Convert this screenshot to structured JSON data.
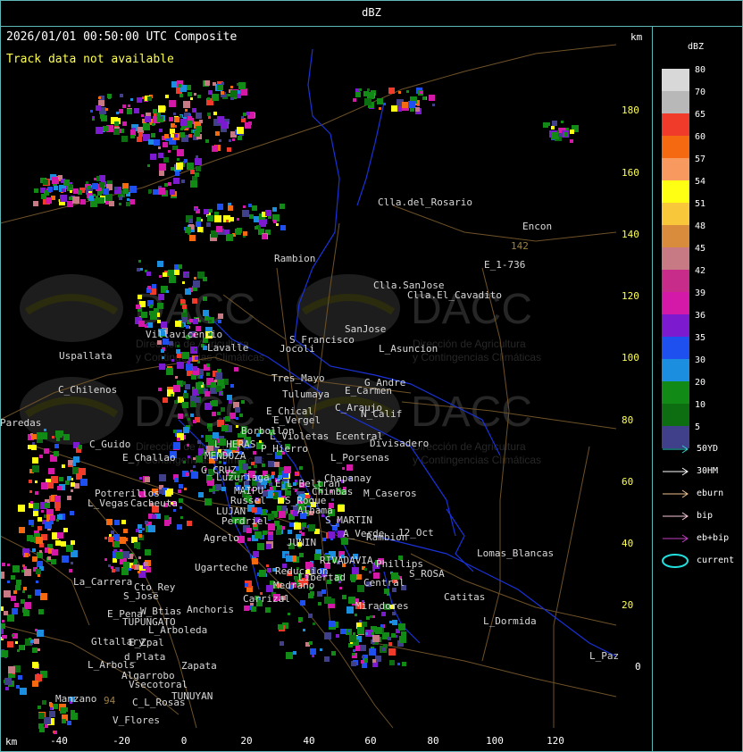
{
  "header": {
    "title": "dBZ"
  },
  "status": {
    "timestamp": "2026/01/01 00:50:00 UTC Composite",
    "track_message": "Track data not available",
    "km_top": "km",
    "km_bottom": "km"
  },
  "axes": {
    "x_ticks": [
      "-40",
      "-20",
      "0",
      "20",
      "40",
      "60",
      "80",
      "100",
      "120"
    ],
    "y_ticks": [
      "180",
      "160",
      "140",
      "120",
      "100",
      "80",
      "60",
      "40",
      "20",
      "0"
    ]
  },
  "legend": {
    "title": "dBZ",
    "scale": [
      {
        "label": "80",
        "color": "#d8d8d8"
      },
      {
        "label": "70",
        "color": "#b8b8b8"
      },
      {
        "label": "65",
        "color": "#f03a2a"
      },
      {
        "label": "60",
        "color": "#f56a10"
      },
      {
        "label": "57",
        "color": "#f89a60"
      },
      {
        "label": "54",
        "color": "#ffff14"
      },
      {
        "label": "51",
        "color": "#f8c83a"
      },
      {
        "label": "48",
        "color": "#d88c3c"
      },
      {
        "label": "45",
        "color": "#c87a84"
      },
      {
        "label": "42",
        "color": "#c82c8a"
      },
      {
        "label": "39",
        "color": "#d418a8"
      },
      {
        "label": "36",
        "color": "#7c1ad0"
      },
      {
        "label": "35",
        "color": "#1e50f0"
      },
      {
        "label": "30",
        "color": "#1c8ee0"
      },
      {
        "label": "20",
        "color": "#128a16"
      },
      {
        "label": "10",
        "color": "#0c6e10"
      },
      {
        "label": "5",
        "color": "#3f3f8a"
      }
    ],
    "tracks": [
      {
        "label": "50YD",
        "color": "#34d0d0"
      },
      {
        "label": "30HM",
        "color": "#ffffff"
      },
      {
        "label": "eburn",
        "color": "#f0c090"
      },
      {
        "label": "bip",
        "color": "#f8c8d8"
      },
      {
        "label": "eb+bip",
        "color": "#c040c0"
      },
      {
        "label": "current",
        "color": "#20e0e0"
      }
    ]
  },
  "watermark": {
    "brand": "DACC",
    "line1": "Dirección de Agricultura",
    "line2": "y Contingencias Climáticas"
  },
  "places": [
    {
      "name": "Clla.del_Rosario",
      "color": "#d8d8d8"
    },
    {
      "name": "Encon",
      "color": "#d8d8d8"
    },
    {
      "name": "142",
      "color": "#a08040"
    },
    {
      "name": "E_1-736",
      "color": "#d8d8d8"
    },
    {
      "name": "Rambion",
      "color": "#d8d8d8"
    },
    {
      "name": "Clla.SanJose",
      "color": "#d8d8d8"
    },
    {
      "name": "Clla.El_Cavadito",
      "color": "#d8d8d8"
    },
    {
      "name": "Villavicencio",
      "color": "#d8d8d8"
    },
    {
      "name": "Uspallata",
      "color": "#d8d8d8"
    },
    {
      "name": "Lavalle",
      "color": "#d8d8d8"
    },
    {
      "name": "S_Francisco",
      "color": "#d8d8d8"
    },
    {
      "name": "SanJose",
      "color": "#d8d8d8"
    },
    {
      "name": "L_Asuncion",
      "color": "#d8d8d8"
    },
    {
      "name": "Jocoli",
      "color": "#d8d8d8"
    },
    {
      "name": "C_Chilenos",
      "color": "#d8d8d8"
    },
    {
      "name": "Tres_Mayo",
      "color": "#d8d8d8"
    },
    {
      "name": "G_Andre",
      "color": "#d8d8d8"
    },
    {
      "name": "Tulumaya",
      "color": "#d8d8d8"
    },
    {
      "name": "E_Carmen",
      "color": "#d8d8d8"
    },
    {
      "name": "E_Chical",
      "color": "#d8d8d8"
    },
    {
      "name": "C_Araujo",
      "color": "#d8d8d8"
    },
    {
      "name": "N_Calif",
      "color": "#d8d8d8"
    },
    {
      "name": "E_Vergel",
      "color": "#d8d8d8"
    },
    {
      "name": "Paredas",
      "color": "#d8d8d8"
    },
    {
      "name": "Borbollon",
      "color": "#d8d8d8"
    },
    {
      "name": "L_Violetas",
      "color": "#d8d8d8"
    },
    {
      "name": "Ecentral",
      "color": "#d8d8d8"
    },
    {
      "name": "Divisadero",
      "color": "#d8d8d8"
    },
    {
      "name": "C_Guido",
      "color": "#d8d8d8"
    },
    {
      "name": "L_HERAS",
      "color": "#d8d8d8"
    },
    {
      "name": "P_Hierro",
      "color": "#d8d8d8"
    },
    {
      "name": "E_Challao",
      "color": "#d8d8d8"
    },
    {
      "name": "MENDOZA",
      "color": "#d8d8d8"
    },
    {
      "name": "L_Porsenas",
      "color": "#d8d8d8"
    },
    {
      "name": "G_CRUZ",
      "color": "#d8d8d8"
    },
    {
      "name": "Chapanay",
      "color": "#d8d8d8"
    },
    {
      "name": "Luzuriaga",
      "color": "#d8d8d8"
    },
    {
      "name": "E_L_Beltran",
      "color": "#d8d8d8"
    },
    {
      "name": "MAIPU",
      "color": "#d8d8d8"
    },
    {
      "name": "Chimbas",
      "color": "#d8d8d8"
    },
    {
      "name": "M_Caseros",
      "color": "#d8d8d8"
    },
    {
      "name": "Potrerillos",
      "color": "#d8d8d8"
    },
    {
      "name": "Russel",
      "color": "#d8d8d8"
    },
    {
      "name": "L_Vegas",
      "color": "#d8d8d8"
    },
    {
      "name": "Cacheuta",
      "color": "#d8d8d8"
    },
    {
      "name": "LUJAN",
      "color": "#d8d8d8"
    },
    {
      "name": "S_Roque",
      "color": "#d8d8d8"
    },
    {
      "name": "Alhama",
      "color": "#d8d8d8"
    },
    {
      "name": "Perdriel",
      "color": "#d8d8d8"
    },
    {
      "name": "S_MARTIN",
      "color": "#d8d8d8"
    },
    {
      "name": "A_Verde",
      "color": "#d8d8d8"
    },
    {
      "name": "Rambion",
      "color": "#d8d8d8"
    },
    {
      "name": "Agrelo",
      "color": "#d8d8d8"
    },
    {
      "name": "JUNIN",
      "color": "#d8d8d8"
    },
    {
      "name": "12_Oct",
      "color": "#d8d8d8"
    },
    {
      "name": "Lomas_Blancas",
      "color": "#d8d8d8"
    },
    {
      "name": "RIVADAVIA",
      "color": "#d8d8d8"
    },
    {
      "name": "Phillips",
      "color": "#d8d8d8"
    },
    {
      "name": "Ugarteche",
      "color": "#d8d8d8"
    },
    {
      "name": "Reduccion",
      "color": "#d8d8d8"
    },
    {
      "name": "S_ROSA",
      "color": "#d8d8d8"
    },
    {
      "name": "La_Carrera",
      "color": "#d8d8d8"
    },
    {
      "name": "Cto_Rey",
      "color": "#d8d8d8"
    },
    {
      "name": "S_Jose",
      "color": "#d8d8d8"
    },
    {
      "name": "Libertad",
      "color": "#d8d8d8"
    },
    {
      "name": "Central",
      "color": "#d8d8d8"
    },
    {
      "name": "Catitas",
      "color": "#d8d8d8"
    },
    {
      "name": "Carrizal",
      "color": "#d8d8d8"
    },
    {
      "name": "Medrano",
      "color": "#d8d8d8"
    },
    {
      "name": "Anchoris",
      "color": "#d8d8d8"
    },
    {
      "name": "W_Btias",
      "color": "#d8d8d8"
    },
    {
      "name": "Miradores",
      "color": "#d8d8d8"
    },
    {
      "name": "E_Pena",
      "color": "#d8d8d8"
    },
    {
      "name": "TUPUNGATO",
      "color": "#d8d8d8"
    },
    {
      "name": "L_Dormida",
      "color": "#d8d8d8"
    },
    {
      "name": "L_Arboleda",
      "color": "#d8d8d8"
    },
    {
      "name": "Gltallary",
      "color": "#d8d8d8"
    },
    {
      "name": "E_Zpal",
      "color": "#d8d8d8"
    },
    {
      "name": "L_Paz",
      "color": "#d8d8d8"
    },
    {
      "name": "d_Plata",
      "color": "#d8d8d8"
    },
    {
      "name": "L_Arbols",
      "color": "#d8d8d8"
    },
    {
      "name": "Zapata",
      "color": "#d8d8d8"
    },
    {
      "name": "Algarrobo",
      "color": "#d8d8d8"
    },
    {
      "name": "Vsecotoral",
      "color": "#d8d8d8"
    },
    {
      "name": "TUNUYAN",
      "color": "#d8d8d8"
    },
    {
      "name": "Manzano",
      "color": "#d8d8d8"
    },
    {
      "name": "94",
      "color": "#a08040"
    },
    {
      "name": "C_L_Rosas",
      "color": "#d8d8d8"
    },
    {
      "name": "V_Flores",
      "color": "#d8d8d8"
    }
  ]
}
